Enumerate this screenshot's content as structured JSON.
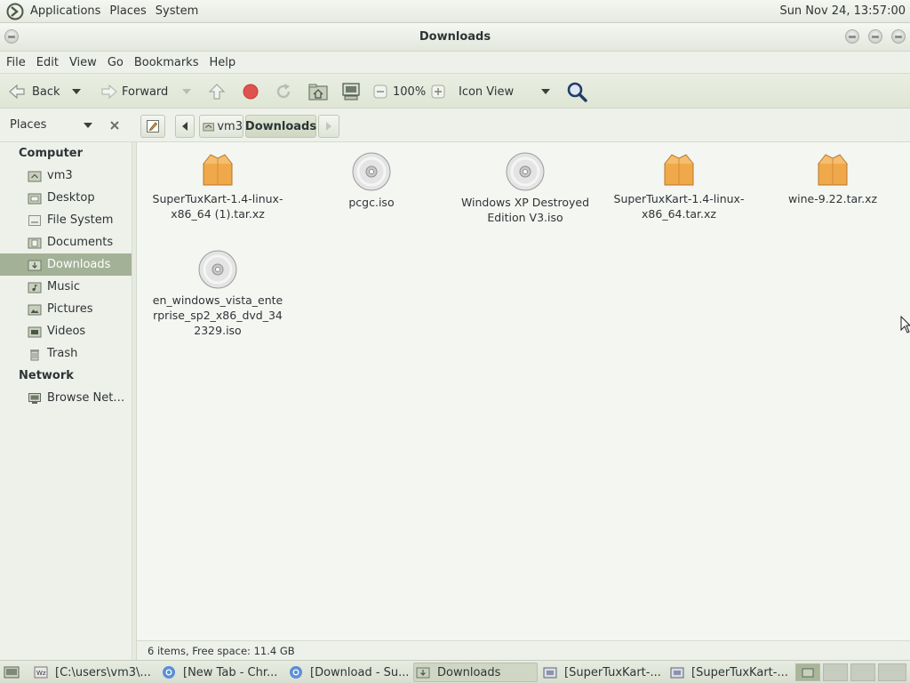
{
  "top_panel": {
    "menus": [
      "Applications",
      "Places",
      "System"
    ],
    "clock": "Sun Nov 24, 13:57:00"
  },
  "window": {
    "title": "Downloads"
  },
  "menubar": [
    "File",
    "Edit",
    "View",
    "Go",
    "Bookmarks",
    "Help"
  ],
  "toolbar": {
    "back_label": "Back",
    "forward_label": "Forward",
    "zoom_level": "100%",
    "view_mode": "Icon View"
  },
  "locationbar": {
    "sidebar_title": "Places",
    "breadcrumbs": [
      "vm3",
      "Downloads"
    ]
  },
  "sidebar": {
    "computer_heading": "Computer",
    "network_heading": "Network",
    "items": [
      {
        "label": "vm3",
        "icon": "home-folder-icon"
      },
      {
        "label": "Desktop",
        "icon": "folder-icon"
      },
      {
        "label": "File System",
        "icon": "drive-icon"
      },
      {
        "label": "Documents",
        "icon": "folder-icon"
      },
      {
        "label": "Downloads",
        "icon": "folder-icon",
        "active": true
      },
      {
        "label": "Music",
        "icon": "folder-icon"
      },
      {
        "label": "Pictures",
        "icon": "folder-icon"
      },
      {
        "label": "Videos",
        "icon": "folder-icon"
      },
      {
        "label": "Trash",
        "icon": "trash-icon"
      }
    ],
    "network_items": [
      {
        "label": "Browse Net…",
        "icon": "network-icon"
      }
    ]
  },
  "files": [
    {
      "name": "SuperTuxKart-1.4-linux-x86_64 (1).tar.xz",
      "icon": "archive-icon"
    },
    {
      "name": "pcgc.iso",
      "icon": "disc-icon"
    },
    {
      "name": "Windows XP Destroyed Edition V3.iso",
      "icon": "disc-icon"
    },
    {
      "name": "SuperTuxKart-1.4-linux-x86_64.tar.xz",
      "icon": "archive-icon"
    },
    {
      "name": "wine-9.22.tar.xz",
      "icon": "archive-icon"
    },
    {
      "name": "en_windows_vista_enterprise_sp2_x86_dvd_342329.iso",
      "icon": "disc-icon"
    }
  ],
  "statusbar": {
    "text": "6 items, Free space: 11.4 GB"
  },
  "taskbar": {
    "tasks": [
      {
        "label": "[C:\\users\\vm3\\...",
        "icon": "wine-icon"
      },
      {
        "label": "[New Tab - Chr...",
        "icon": "chrome-icon"
      },
      {
        "label": "[Download - Su...",
        "icon": "chrome-icon"
      },
      {
        "label": "Downloads",
        "icon": "folder-icon",
        "active": true
      },
      {
        "label": "[SuperTuxKart-...",
        "icon": "archive-manager-icon"
      },
      {
        "label": "[SuperTuxKart-...",
        "icon": "archive-manager-icon"
      }
    ]
  },
  "colors": {
    "accent": "#a3b196",
    "archive": "#f0a94a",
    "background": "#eef1ea"
  }
}
